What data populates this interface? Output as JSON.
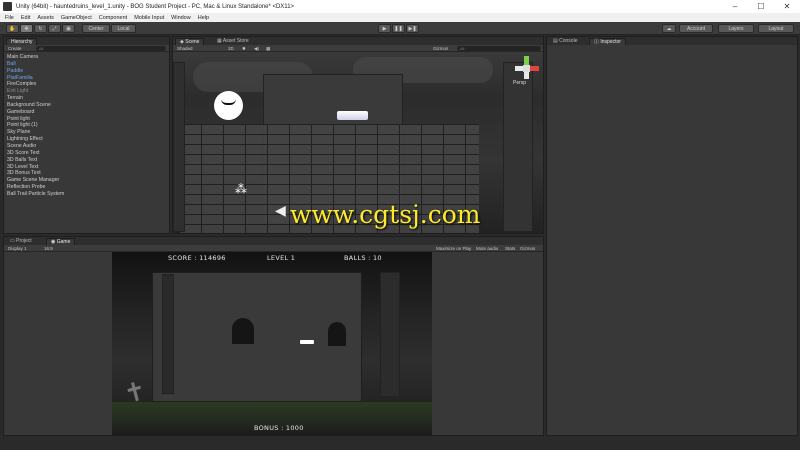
{
  "window": {
    "title": "Unity (64bit) - hauntedruins_level_1.unity - BOG Student Project - PC, Mac & Linux Standalone* <DX11>",
    "controls": [
      "–",
      "☐",
      "✕"
    ]
  },
  "menu": [
    "File",
    "Edit",
    "Assets",
    "GameObject",
    "Component",
    "Mobile Input",
    "Window",
    "Help"
  ],
  "toolbar": {
    "pivot": "Center",
    "space": "Local",
    "play": "▶",
    "pause": "❚❚",
    "step": "▶❚",
    "account": "Account",
    "layers": "Layers",
    "layout": "Layout"
  },
  "hierarchy": {
    "tab": "Hierarchy",
    "create": "Create",
    "search_placeholder": "All",
    "items": [
      {
        "label": "Main Camera",
        "style": "normal"
      },
      {
        "label": "Ball",
        "style": "blue"
      },
      {
        "label": "Paddle",
        "style": "blue"
      },
      {
        "label": "PlatFamilia",
        "style": "blue"
      },
      {
        "label": "FireComplex",
        "style": "normal"
      },
      {
        "label": "Exit Light",
        "style": "grey"
      },
      {
        "label": "Terrain",
        "style": "normal"
      },
      {
        "label": "Background Scene",
        "style": "normal"
      },
      {
        "label": "Gameboard",
        "style": "normal"
      },
      {
        "label": "Point light",
        "style": "normal"
      },
      {
        "label": "Point light (1)",
        "style": "normal"
      },
      {
        "label": "Sky Plane",
        "style": "normal"
      },
      {
        "label": "Lightning Effect",
        "style": "normal"
      },
      {
        "label": "Scene Audio",
        "style": "normal"
      },
      {
        "label": "3D Score Text",
        "style": "normal"
      },
      {
        "label": "3D Balls Text",
        "style": "normal"
      },
      {
        "label": "3D Level Text",
        "style": "normal"
      },
      {
        "label": "3D Bonus Text",
        "style": "normal"
      },
      {
        "label": "Game Scene Manager",
        "style": "normal"
      },
      {
        "label": "Reflection Probe",
        "style": "normal"
      },
      {
        "label": "Ball Trail Particle System",
        "style": "normal"
      }
    ]
  },
  "scene": {
    "tab": "Scene",
    "tab2": "Asset Store",
    "shading": "Shaded",
    "mode2d": "2D",
    "gizmos": "Gizmos",
    "search_placeholder": "All",
    "persp": "Persp"
  },
  "console": {
    "tab": "Console"
  },
  "inspector": {
    "tab": "Inspector"
  },
  "project": {
    "tab": "Project"
  },
  "game": {
    "tab": "Game",
    "display": "Display 1",
    "aspect": "16:9",
    "maximize": "Maximize on Play",
    "mute": "Mute audio",
    "stats": "Stats",
    "gizmos": "Gizmos",
    "score": "SCORE : 114696",
    "level": "LEVEL 1",
    "balls": "BALLS : 10",
    "bonus": "BONUS : 1000"
  },
  "watermark": "www.cgtsj.com",
  "colors": {
    "editor_bg": "#383838",
    "selected_blue": "#6fa6e8",
    "watermark": "#ffea2a"
  }
}
